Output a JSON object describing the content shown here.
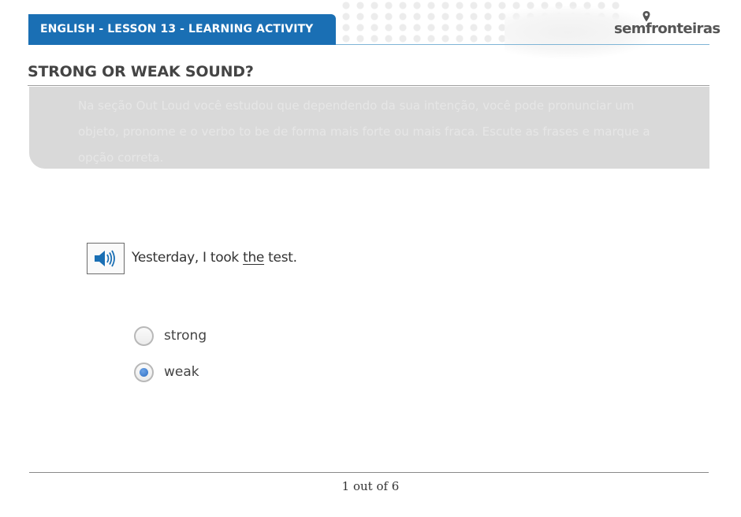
{
  "header": {
    "title": "ENGLISH - LESSON 13 - LEARNING ACTIVITY",
    "brand_color": "#1a6fb4"
  },
  "logo": {
    "part1": "sem",
    "part2": "fronteiras",
    "icon": "location-pin-icon"
  },
  "page": {
    "title": "STRONG OR WEAK SOUND?"
  },
  "instructions": {
    "text": "Na seção Out Loud você estudou que dependendo da sua intenção, você pode pronunciar um objeto, pronome e o verbo to be de forma mais forte ou mais fraca. Escute as frases e marque a opção correta."
  },
  "question": {
    "audio_icon": "speaker-icon",
    "sentence_before": "Yesterday, I took ",
    "highlighted_word": "the",
    "sentence_after": " test."
  },
  "options": [
    {
      "label": "strong",
      "selected": false
    },
    {
      "label": "weak",
      "selected": true
    }
  ],
  "footer": {
    "pagination": "1 out of 6"
  }
}
